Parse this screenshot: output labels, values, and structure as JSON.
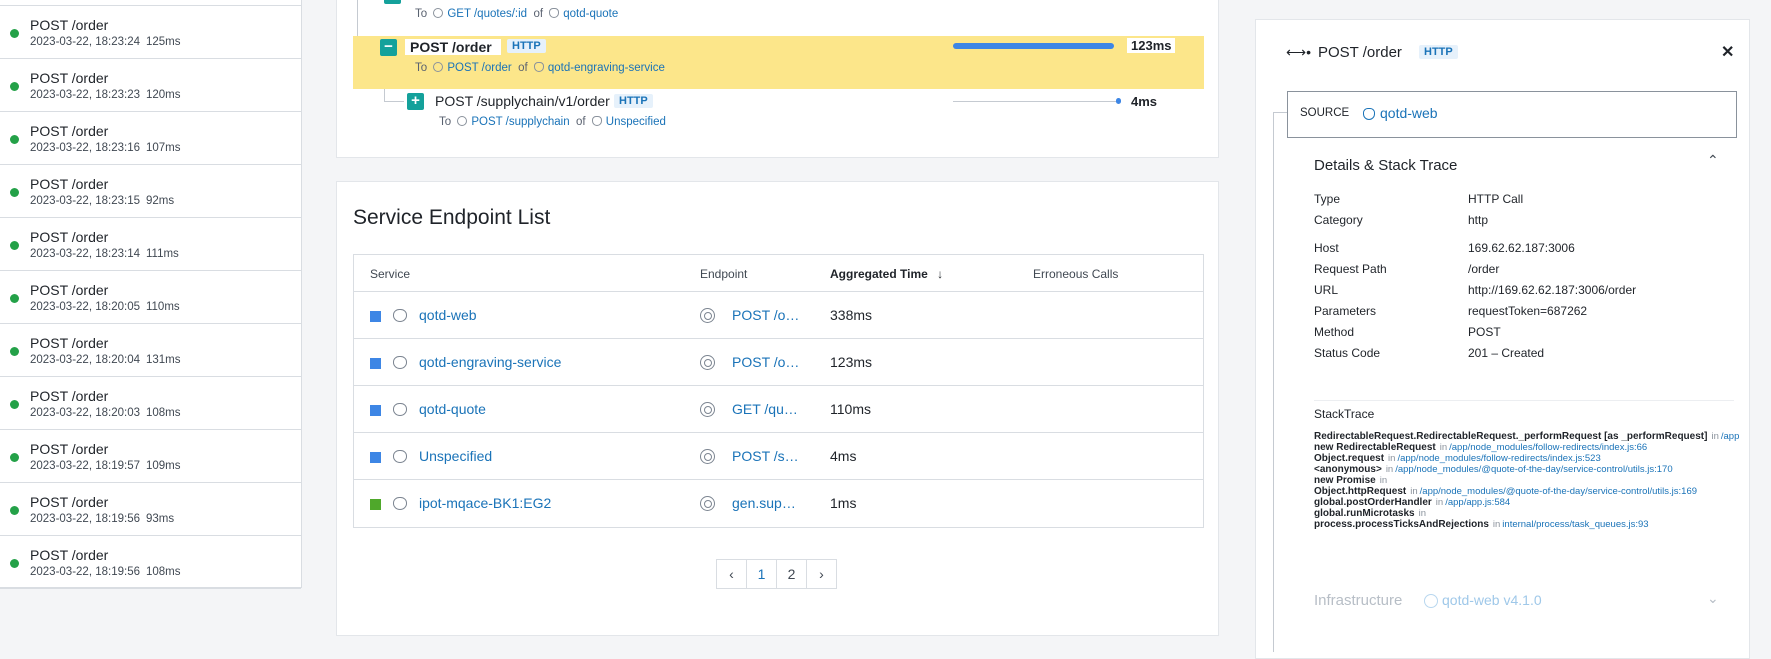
{
  "traces": [
    {
      "name": "",
      "date": "",
      "duration": ""
    },
    {
      "name": "POST /order",
      "date": "2023-03-22, 18:23:24",
      "duration": "125ms"
    },
    {
      "name": "POST /order",
      "date": "2023-03-22, 18:23:23",
      "duration": "120ms"
    },
    {
      "name": "POST /order",
      "date": "2023-03-22, 18:23:16",
      "duration": "107ms"
    },
    {
      "name": "POST /order",
      "date": "2023-03-22, 18:23:15",
      "duration": "92ms"
    },
    {
      "name": "POST /order",
      "date": "2023-03-22, 18:23:14",
      "duration": "111ms"
    },
    {
      "name": "POST /order",
      "date": "2023-03-22, 18:20:05",
      "duration": "110ms"
    },
    {
      "name": "POST /order",
      "date": "2023-03-22, 18:20:04",
      "duration": "131ms"
    },
    {
      "name": "POST /order",
      "date": "2023-03-22, 18:20:03",
      "duration": "108ms"
    },
    {
      "name": "POST /order",
      "date": "2023-03-22, 18:19:57",
      "duration": "109ms"
    },
    {
      "name": "POST /order",
      "date": "2023-03-22, 18:19:56",
      "duration": "93ms"
    },
    {
      "name": "POST /order",
      "date": "2023-03-22, 18:19:56",
      "duration": "108ms"
    }
  ],
  "flow": {
    "top_sub": {
      "to": "To",
      "endpoint": "GET /quotes/:id",
      "of": "of",
      "service": "qotd-quote"
    },
    "selected": {
      "name": "POST /order",
      "tag": "HTTP",
      "duration": "123ms",
      "bar_fraction": 0.96,
      "to": "To",
      "endpoint": "POST /order",
      "of": "of",
      "service": "qotd-engraving-service",
      "toggle": "−"
    },
    "child": {
      "name": "POST /supplychain/v1/order",
      "tag": "HTTP",
      "duration": "4ms",
      "bar_fraction": 0.03,
      "to": "To",
      "endpoint": "POST /supplychain",
      "of": "of",
      "service": "Unspecified",
      "toggle": "+"
    }
  },
  "endpoint_list": {
    "title": "Service Endpoint List",
    "columns": {
      "service": "Service",
      "endpoint": "Endpoint",
      "time": "Aggregated Time",
      "errors": "Erroneous Calls"
    },
    "rows": [
      {
        "service": "qotd-web",
        "endpoint": "POST /o…",
        "time": "338ms",
        "color": "#3d86e5"
      },
      {
        "service": "qotd-engraving-service",
        "endpoint": "POST /o…",
        "time": "123ms",
        "color": "#3d86e5"
      },
      {
        "service": "qotd-quote",
        "endpoint": "GET /qu…",
        "time": "110ms",
        "color": "#3d86e5"
      },
      {
        "service": "Unspecified",
        "endpoint": "POST /s…",
        "time": "4ms",
        "color": "#3d86e5"
      },
      {
        "service": "ipot-mqace-BK1:EG2",
        "endpoint": "gen.sup…",
        "time": "1ms",
        "color": "#4fa82b"
      }
    ],
    "pager": {
      "prev": "‹",
      "pages": [
        "1",
        "2"
      ],
      "next": "›",
      "current": "1"
    }
  },
  "details": {
    "title": "POST /order",
    "tag": "HTTP",
    "close": "✕",
    "source_label": "SOURCE",
    "source_value": "qotd-web",
    "section_title": "Details & Stack Trace",
    "fields": [
      {
        "key": "Type",
        "value": "HTTP Call"
      },
      {
        "key": "Category",
        "value": "http"
      },
      {
        "key": "Host",
        "value": "169.62.62.187:3006"
      },
      {
        "key": "Request Path",
        "value": "/order"
      },
      {
        "key": "URL",
        "value": "http://169.62.62.187:3006/order"
      },
      {
        "key": "Parameters",
        "value": "requestToken=687262"
      },
      {
        "key": "Method",
        "value": "POST"
      },
      {
        "key": "Status Code",
        "value": "201 – Created"
      }
    ],
    "stack_label": "StackTrace",
    "stack": [
      {
        "fn": "RedirectableRequest.RedirectableRequest._performRequest [as _performRequest]",
        "in": "in",
        "loc": "/app"
      },
      {
        "fn": "new RedirectableRequest",
        "in": "in",
        "loc": "/app/node_modules/follow-redirects/index.js:66"
      },
      {
        "fn": "Object.request",
        "in": "in",
        "loc": "/app/node_modules/follow-redirects/index.js:523"
      },
      {
        "fn": "<anonymous>",
        "in": "in",
        "loc": "/app/node_modules/@quote-of-the-day/service-control/utils.js:170"
      },
      {
        "fn": "new Promise",
        "in": "in",
        "loc": ""
      },
      {
        "fn": "Object.httpRequest",
        "in": "in",
        "loc": "/app/node_modules/@quote-of-the-day/service-control/utils.js:169"
      },
      {
        "fn": "global.postOrderHandler",
        "in": "in",
        "loc": "/app/app.js:584"
      },
      {
        "fn": "global.runMicrotasks",
        "in": "in",
        "loc": ""
      },
      {
        "fn": "process.processTicksAndRejections",
        "in": "in",
        "loc": "internal/process/task_queues.js:93"
      }
    ],
    "infra_title": "Infrastructure",
    "infra_value": "qotd-web v4.1.0"
  }
}
